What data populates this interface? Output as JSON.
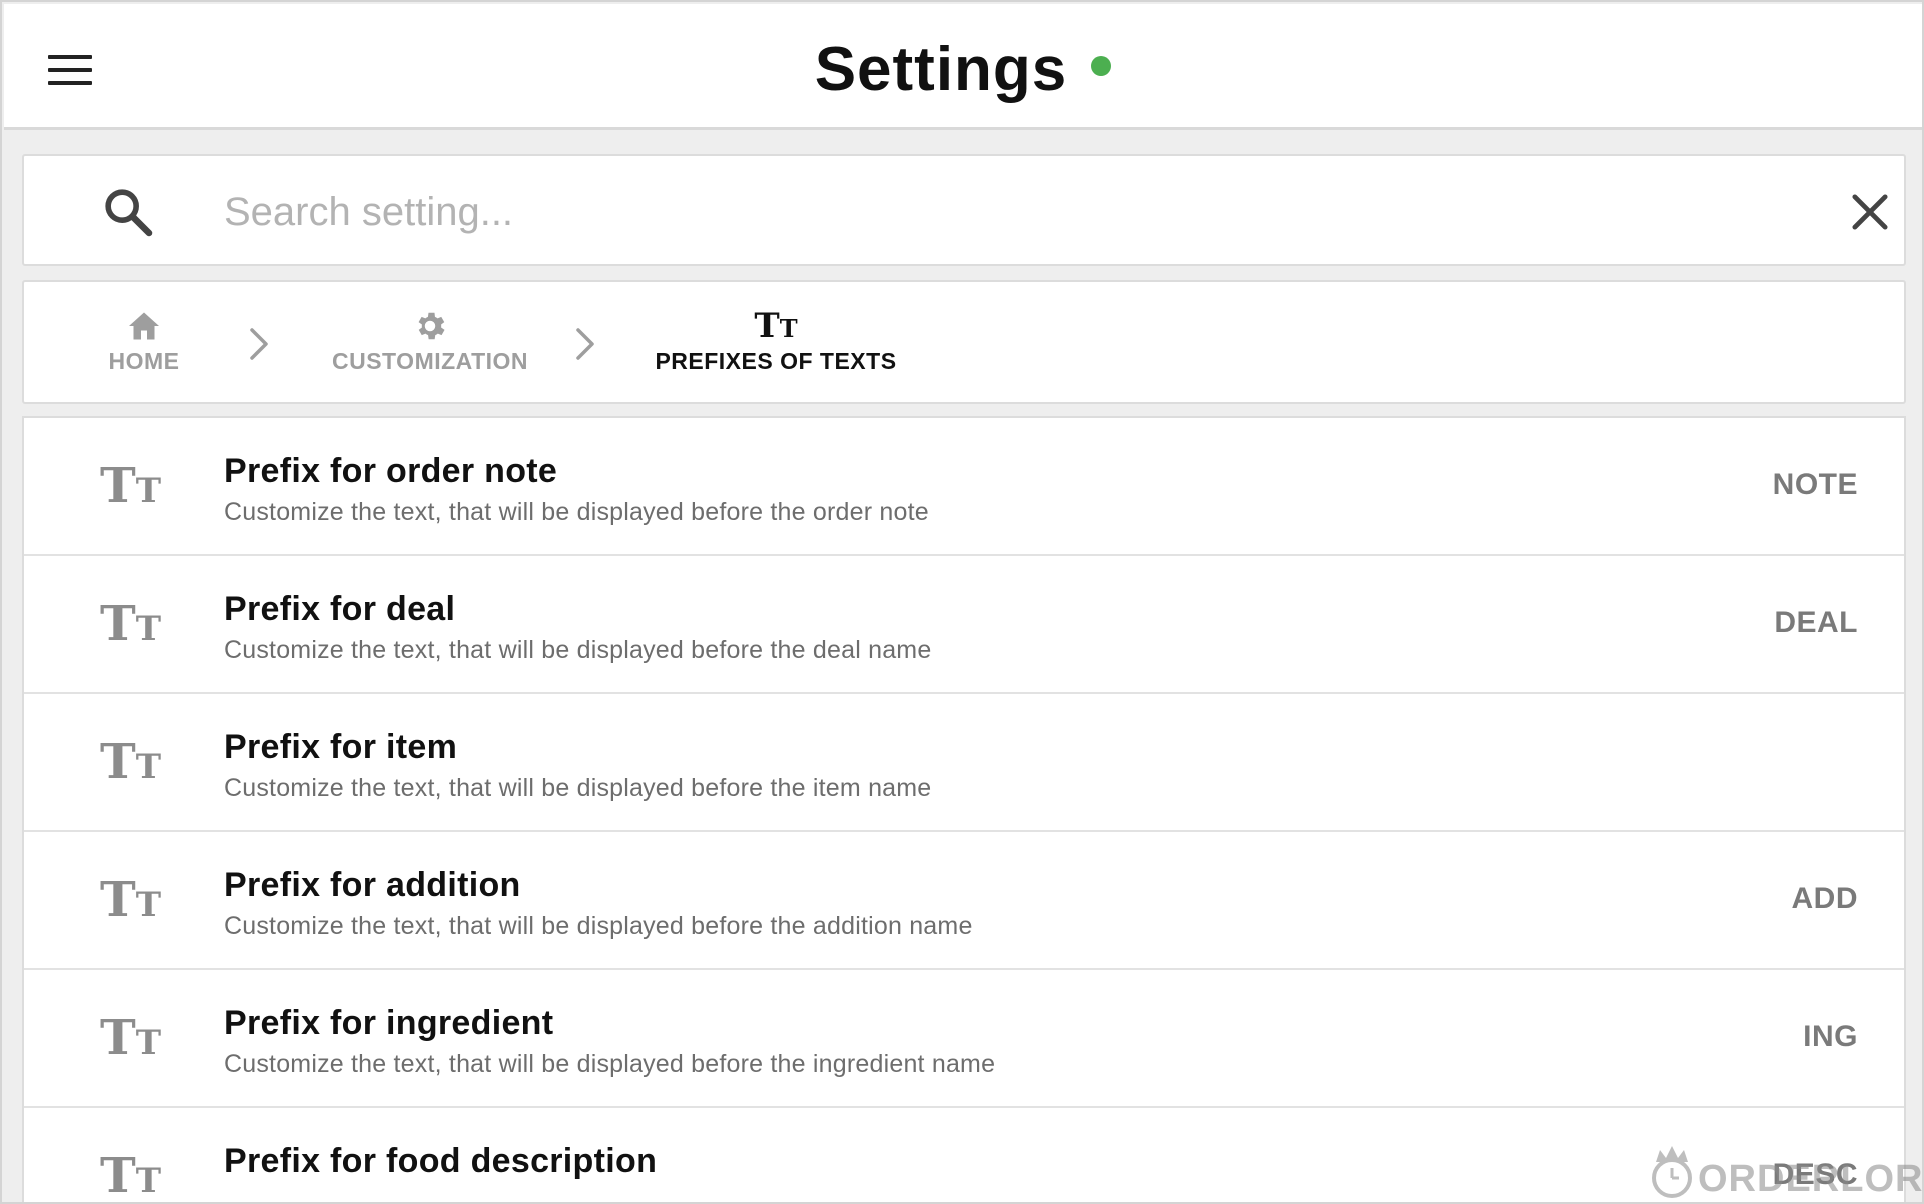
{
  "header": {
    "title": "Settings",
    "status_color": "#4caf50",
    "menu_icon": "hamburger-menu-icon"
  },
  "search": {
    "placeholder": "Search setting...",
    "value": "",
    "search_icon": "search-icon",
    "clear_icon": "close-icon"
  },
  "breadcrumb": {
    "items": [
      {
        "label": "HOME",
        "icon": "home-icon",
        "active": false
      },
      {
        "label": "CUSTOMIZATION",
        "icon": "gear-icon",
        "active": false
      },
      {
        "label": "PREFIXES OF TEXTS",
        "icon": "text-size-icon",
        "active": true
      }
    ],
    "separator_icon": "chevron-right-icon"
  },
  "settings": [
    {
      "title": "Prefix for order note",
      "description": "Customize the text, that will be displayed before the order note",
      "value": "NOTE",
      "icon": "text-size-icon"
    },
    {
      "title": "Prefix for deal",
      "description": "Customize the text, that will be displayed before the deal name",
      "value": "DEAL",
      "icon": "text-size-icon"
    },
    {
      "title": "Prefix for item",
      "description": "Customize the text, that will be displayed before the item name",
      "value": "",
      "icon": "text-size-icon"
    },
    {
      "title": "Prefix for addition",
      "description": "Customize the text, that will be displayed before the addition name",
      "value": "ADD",
      "icon": "text-size-icon"
    },
    {
      "title": "Prefix for ingredient",
      "description": "Customize the text, that will be displayed before the ingredient name",
      "value": "ING",
      "icon": "text-size-icon"
    },
    {
      "title": "Prefix for food description",
      "description": "",
      "value": "DESC",
      "icon": "text-size-icon"
    }
  ],
  "watermark": {
    "text": "ORDERLORD",
    "icon": "orderlord-logo-icon"
  },
  "colors": {
    "background": "#eeeeee",
    "card": "#ffffff",
    "icon_gray": "#8c8c8c",
    "status_green": "#4caf50"
  }
}
